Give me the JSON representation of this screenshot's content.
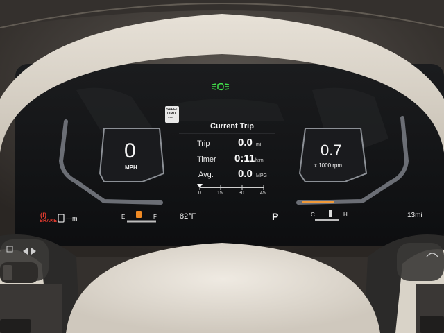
{
  "cluster": {
    "trip_panel": {
      "title": "Current Trip",
      "rows": [
        {
          "label": "Trip",
          "value": "0.0",
          "unit": "mi"
        },
        {
          "label": "Timer",
          "value": "0:11",
          "unit": "h:m"
        },
        {
          "label": "Avg.",
          "value": "0.0",
          "unit": "MPG"
        }
      ],
      "scale_ticks": [
        "0",
        "15",
        "30",
        "45"
      ]
    },
    "speed": {
      "value": "0",
      "unit": "MPH"
    },
    "tach": {
      "value": "0.7",
      "unit": "x 1000 rpm"
    },
    "speed_limit_sign": [
      "SPEED",
      "LIMIT",
      "---"
    ],
    "brake_warning": {
      "symbol": "(!)",
      "label": "BRAKE"
    },
    "range": {
      "value": "---mi"
    },
    "fuel": {
      "empty": "E",
      "full": "F"
    },
    "outside_temp": "82°F",
    "gear": "P",
    "coolant": {
      "cold": "C",
      "hot": "H"
    },
    "odometer_right": "13mi",
    "colors": {
      "brake": "#e53b2f",
      "fuel_icon": "#f08a24",
      "lamp": "#41e24a",
      "coolant_bar": "#f09a3a"
    }
  }
}
